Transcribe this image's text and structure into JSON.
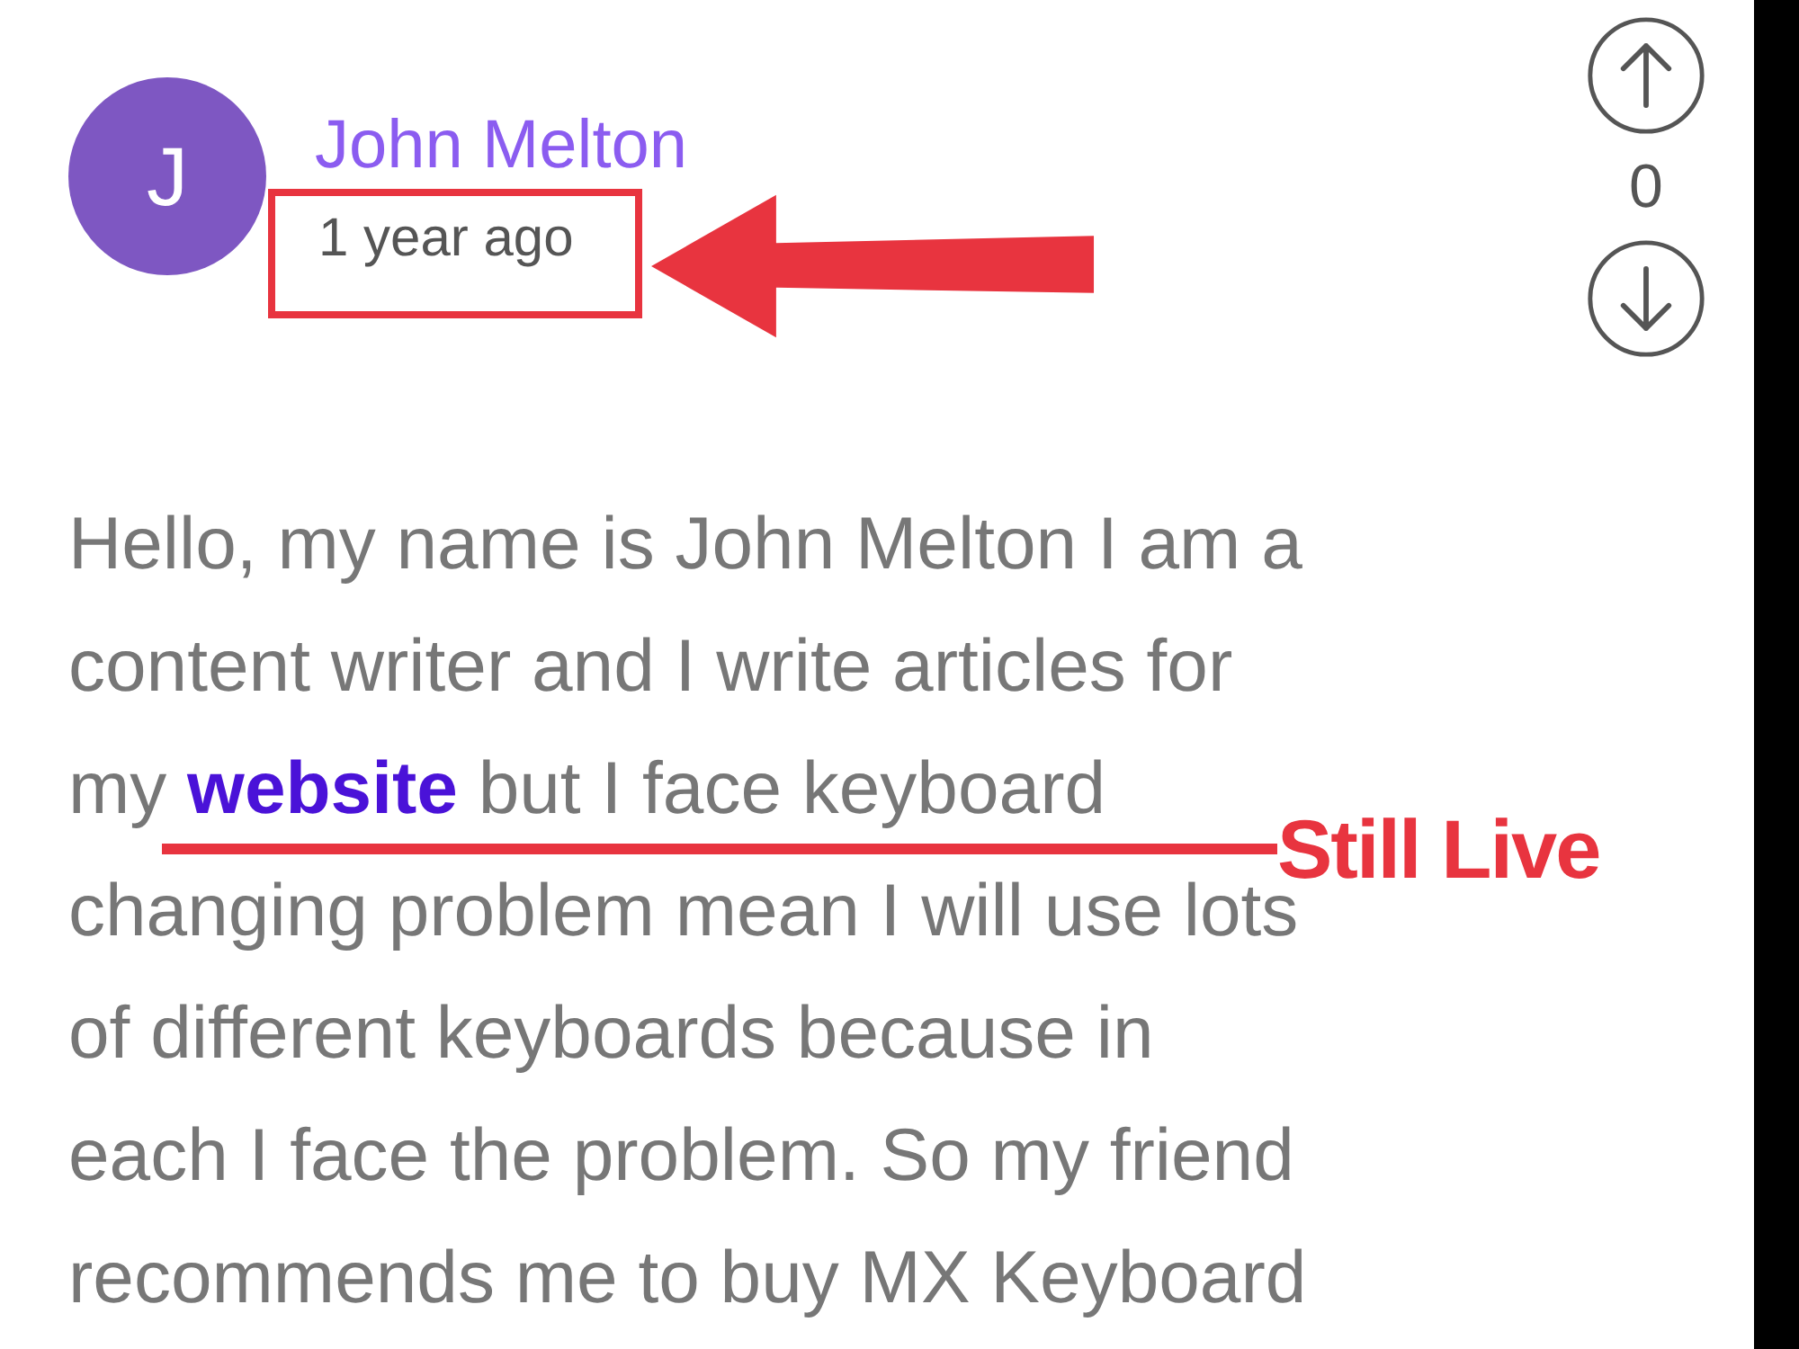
{
  "comment": {
    "author": "John Melton",
    "avatar_letter": "J",
    "time": "1 year ago",
    "body_lines": [
      [
        {
          "text": "Hello, my name is John Melton I am a"
        }
      ],
      [
        {
          "text": "content writer and I write articles for"
        }
      ],
      [
        {
          "text": "my "
        },
        {
          "text": "website",
          "kind": "link"
        },
        {
          "text": " but I face keyboard"
        }
      ],
      [
        {
          "text": "changing problem mean I will use lots"
        }
      ],
      [
        {
          "text": "of different keyboards because in"
        }
      ],
      [
        {
          "text": "each I face the problem. So my friend"
        }
      ],
      [
        {
          "text": "recommends me to buy MX Keyboard"
        }
      ]
    ]
  },
  "votes": {
    "count": "0"
  },
  "annotations": [
    {
      "kind": "box"
    },
    {
      "kind": "arrow"
    },
    {
      "kind": "underline"
    },
    {
      "kind": "label",
      "text": "Still Live"
    }
  ]
}
